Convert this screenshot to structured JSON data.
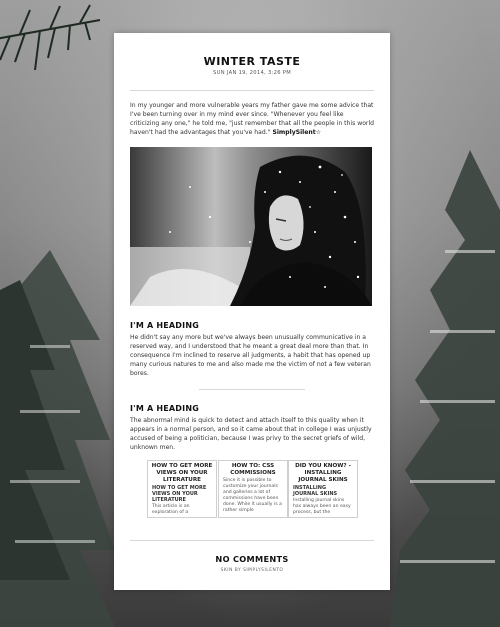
{
  "post": {
    "title": "WINTER TASTE",
    "date": "SUN JAN 19, 2014, 3:26 PM",
    "intro": "In my younger and more vulnerable years my father gave me some advice that I've been turning over in my mind ever since. \"Whenever you feel like criticizing any one,\" he told me, \"just remember that all the people in this world haven't had the advantages that you've had.\"",
    "intro_signature": "SimplySilent☆",
    "photo_icon": "woman-in-snow-photo",
    "heading1": "I'M A HEADING",
    "paragraph1": "He didn't say any more but we've always been unusually communicative in a reserved way, and I understood that he meant a great deal more than that. In consequence I'm inclined to reserve all judgments, a habit that has opened up many curious natures to me and also made me the victim of not a few veteran bores.",
    "heading2": "I'M A HEADING",
    "paragraph2": "The abnormal mind is quick to detect and attach itself to this quality when it appears in a normal person, and so it came about that in college I was unjustly accused of being a politician, because I was privy to the secret griefs of wild, unknown men."
  },
  "related": [
    {
      "title": "HOW TO GET MORE VIEWS ON YOUR LITERATURE",
      "subtitle": "HOW TO GET MORE VIEWS ON YOUR LITERATURE",
      "snippet": "This article is an exploration of a"
    },
    {
      "title": "HOW TO: CSS COMMISSIONS",
      "subtitle": "",
      "snippet": "Since it is possible to customize your journals and galleries a lot of commissions have been done. While it usually is a rather simple"
    },
    {
      "title": "DID YOU KNOW? - INSTALLING JOURNAL SKINS",
      "subtitle": "INSTALLING JOURNAL SKINS",
      "snippet": "Installing journal skins has always been an easy process, but the"
    }
  ],
  "footer": {
    "comments": "NO COMMENTS",
    "skin_credit": "SKIN BY SIMPLYSILENTO"
  },
  "colors": {
    "card": "#ffffff",
    "text": "#333333",
    "heading": "#111111",
    "background": "#8a8a8a"
  }
}
